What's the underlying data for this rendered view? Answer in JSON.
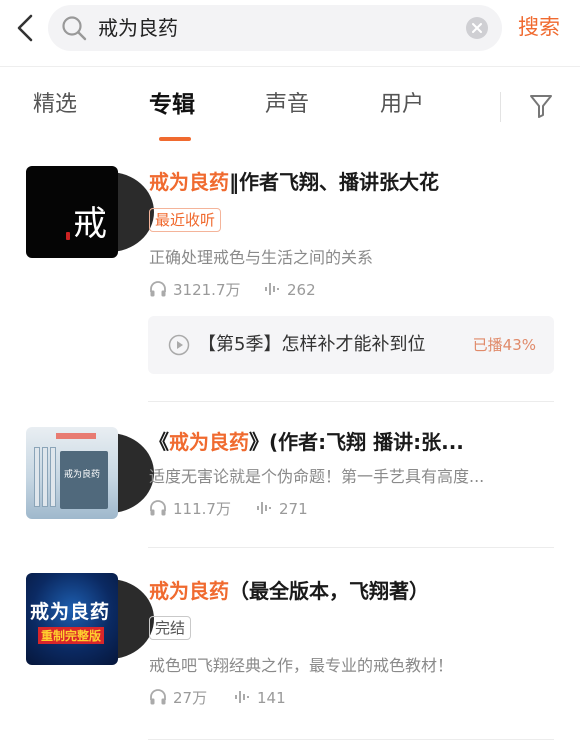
{
  "search": {
    "query": "戒为良药",
    "button_label": "搜索"
  },
  "tabs": [
    {
      "label": "精选"
    },
    {
      "label": "专辑"
    },
    {
      "label": "声音"
    },
    {
      "label": "用户"
    }
  ],
  "results": [
    {
      "title_highlight": "戒为良药",
      "title_rest": "‖作者飞翔、播讲张大花",
      "cover_text": "戒",
      "tag": "最近收听",
      "description": "正确处理戒色与生活之间的关系",
      "plays": "3121.7万",
      "tracks": "262",
      "last_played": {
        "episode": "【第5季】怎样补才能补到位",
        "progress_label": "已播43%"
      }
    },
    {
      "title_prefix": "《",
      "title_highlight": "戒为良药",
      "title_rest": "》(作者:飞翔 播讲:张...",
      "cover_text": "戒为良药",
      "description": "适度无害论就是个伪命题！第一手艺具有高度...",
      "plays": "111.7万",
      "tracks": "271"
    },
    {
      "title_highlight": "戒为良药",
      "title_rest": "（最全版本，飞翔著）",
      "cover_text": "戒为良药",
      "cover_subtext": "重制完整版",
      "tag": "完结",
      "description": "戒色吧飞翔经典之作，最专业的戒色教材！",
      "plays": "27万",
      "tracks": "141"
    }
  ],
  "colors": {
    "accent": "#f06a2f",
    "text_secondary": "#8a8a8a"
  },
  "icons": [
    "back-arrow-icon",
    "search-icon",
    "clear-icon",
    "filter-icon",
    "headphones-icon",
    "sound-wave-icon",
    "play-circle-icon"
  ]
}
